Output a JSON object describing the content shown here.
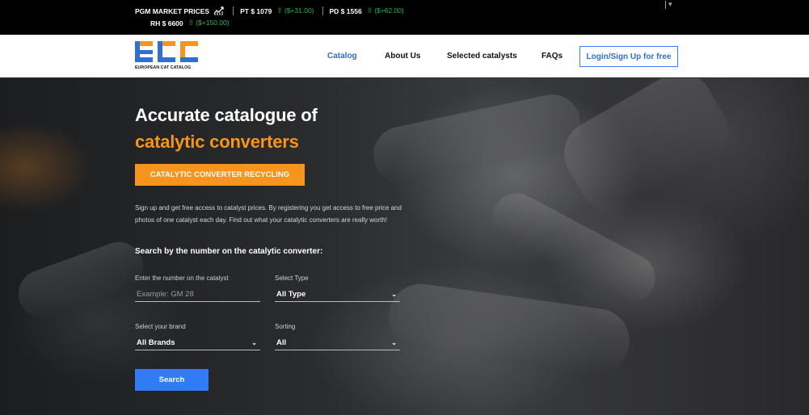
{
  "ticker": {
    "market_label": "PGM MARKET PRICES",
    "pt_label": "PT $ 1079",
    "pt_change": "($+31.00)",
    "pd_label": "PD $ 1556",
    "pd_change": "($+62.00)",
    "rh_label": "RH $ 6600",
    "rh_change": "($+150.00)",
    "up_color": "#34b24a"
  },
  "nav": {
    "logo_text": "EUROPEAN CAT CATALOG",
    "links": [
      "Catalog",
      "About Us",
      "Selected catalysts",
      "FAQs"
    ],
    "active": "Catalog",
    "login": "Login/Sign Up for free",
    "accent": "#2f6fd1"
  },
  "hero": {
    "title_line1": "Accurate catalogue of",
    "title_line2": "catalytic converters",
    "recycle_button": "CATALYTIC CONVERTER RECYCLING",
    "description": "Sign up and get free access to catalyst prices. By registering you get access to free price and photos of one catalyst each day. Find out what your catalytic converters are really worth!",
    "search_title": "Search by the number on the catalytic converter:",
    "orange": "#f7941d"
  },
  "form": {
    "number_label": "Enter the number on the catalyst",
    "number_placeholder": "Example: GM 28",
    "type_label": "Select Type",
    "type_value": "All Type",
    "brand_label": "Select your brand",
    "brand_value": "All Brands",
    "sorting_label": "Sorting",
    "sorting_value": "All",
    "search_button": "Search"
  }
}
